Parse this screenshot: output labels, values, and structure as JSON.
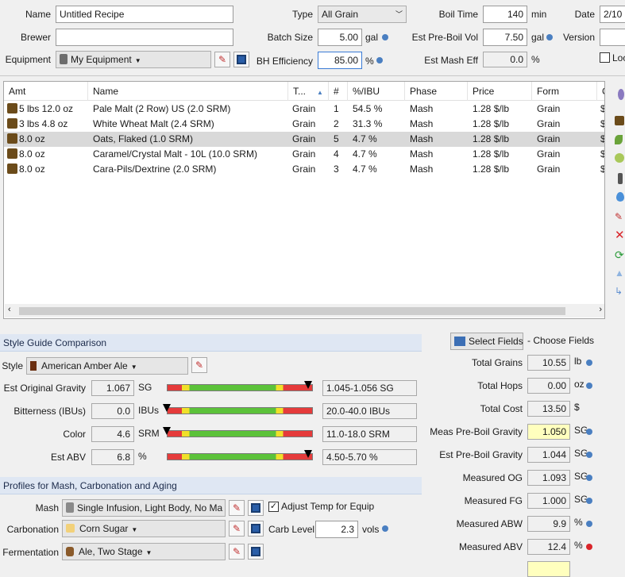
{
  "header": {
    "name_label": "Name",
    "name_value": "Untitled Recipe",
    "brewer_label": "Brewer",
    "brewer_value": "",
    "equipment_label": "Equipment",
    "equipment_value": "My Equipment",
    "type_label": "Type",
    "type_value": "All Grain",
    "batch_label": "Batch Size",
    "batch_value": "5.00",
    "batch_unit": "gal",
    "bh_label": "BH Efficiency",
    "bh_value": "85.00",
    "bh_unit": "%",
    "boil_label": "Boil Time",
    "boil_value": "140",
    "boil_unit": "min",
    "preboil_label": "Est Pre-Boil Vol",
    "preboil_value": "7.50",
    "preboil_unit": "gal",
    "mash_eff_label": "Est Mash Eff",
    "mash_eff_value": "0.0",
    "mash_eff_unit": "%",
    "date_label": "Date",
    "date_value": "2/10",
    "version_label": "Version",
    "version_value": "",
    "lock_label": "Loc"
  },
  "grid": {
    "columns": [
      "Amt",
      "Name",
      "T...",
      "#",
      "%/IBU",
      "Phase",
      "Price",
      "Form",
      "C"
    ],
    "rows": [
      {
        "amt": "5 lbs 12.0 oz",
        "name": "Pale Malt (2 Row) US (2.0 SRM)",
        "type": "Grain",
        "num": "1",
        "pct": "54.5 %",
        "phase": "Mash",
        "price": "1.28 $/lb",
        "form": "Grain",
        "c": "$"
      },
      {
        "amt": "3 lbs 4.8 oz",
        "name": "White Wheat Malt (2.4 SRM)",
        "type": "Grain",
        "num": "2",
        "pct": "31.3 %",
        "phase": "Mash",
        "price": "1.28 $/lb",
        "form": "Grain",
        "c": "$"
      },
      {
        "amt": "8.0 oz",
        "name": "Oats, Flaked (1.0 SRM)",
        "type": "Grain",
        "num": "5",
        "pct": "4.7 %",
        "phase": "Mash",
        "price": "1.28 $/lb",
        "form": "Grain",
        "c": "$"
      },
      {
        "amt": "8.0 oz",
        "name": "Caramel/Crystal Malt - 10L (10.0 SRM)",
        "type": "Grain",
        "num": "4",
        "pct": "4.7 %",
        "phase": "Mash",
        "price": "1.28 $/lb",
        "form": "Grain",
        "c": "$"
      },
      {
        "amt": "8.0 oz",
        "name": "Cara-Pils/Dextrine (2.0 SRM)",
        "type": "Grain",
        "num": "3",
        "pct": "4.7 %",
        "phase": "Mash",
        "price": "1.28 $/lb",
        "form": "Grain",
        "c": "$"
      }
    ],
    "selected_row": 2
  },
  "style_guide": {
    "title": "Style Guide Comparison",
    "style_label": "Style",
    "style_value": "American Amber Ale",
    "metrics": [
      {
        "label": "Est Original Gravity",
        "value": "1.067",
        "unit": "SG",
        "range": "1.045-1.056 SG",
        "marker": 0.97
      },
      {
        "label": "Bitterness (IBUs)",
        "value": "0.0",
        "unit": "IBUs",
        "range": "20.0-40.0 IBUs",
        "marker": 0.0
      },
      {
        "label": "Color",
        "value": "4.6",
        "unit": "SRM",
        "range": "11.0-18.0 SRM",
        "marker": 0.0
      },
      {
        "label": "Est ABV",
        "value": "6.8",
        "unit": "%",
        "range": "4.50-5.70 %",
        "marker": 0.97
      }
    ]
  },
  "profiles": {
    "title": "Profiles for Mash, Carbonation and Aging",
    "mash_label": "Mash",
    "mash_value": "Single Infusion, Light Body, No Ma",
    "adjust_label": "Adjust Temp for Equip",
    "adjust_checked": true,
    "carb_label": "Carbonation",
    "carb_value": "Corn Sugar",
    "carb_level_label": "Carb Level",
    "carb_level_value": "2.3",
    "carb_level_unit": "vols",
    "ferm_label": "Fermentation",
    "ferm_value": "Ale, Two Stage"
  },
  "fields": {
    "select_button": "Select Fields",
    "choose_label": "- Choose Fields",
    "items": [
      {
        "label": "Total Grains",
        "value": "10.55",
        "unit": "lb",
        "dot": "blue"
      },
      {
        "label": "Total Hops",
        "value": "0.00",
        "unit": "oz",
        "dot": "blue"
      },
      {
        "label": "Total Cost",
        "value": "13.50",
        "unit": "$",
        "dot": ""
      },
      {
        "label": "Meas Pre-Boil Gravity",
        "value": "1.050",
        "unit": "SG",
        "dot": "blue"
      },
      {
        "label": "Est Pre-Boil Gravity",
        "value": "1.044",
        "unit": "SG",
        "dot": "blue"
      },
      {
        "label": "Measured OG",
        "value": "1.093",
        "unit": "SG",
        "dot": "blue"
      },
      {
        "label": "Measured FG",
        "value": "1.000",
        "unit": "SG",
        "dot": "blue"
      },
      {
        "label": "Measured ABW",
        "value": "9.9",
        "unit": "%",
        "dot": "blue"
      },
      {
        "label": "Measured ABV",
        "value": "12.4",
        "unit": "%",
        "dot": "red"
      }
    ]
  }
}
